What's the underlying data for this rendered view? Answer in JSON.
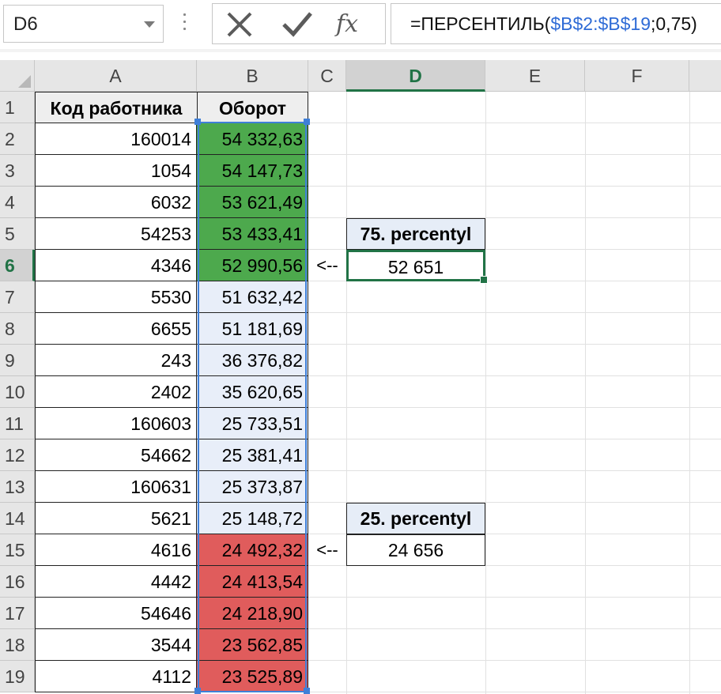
{
  "name_box": {
    "value": "D6"
  },
  "formula_bar": {
    "cancel_icon": "close-x-icon",
    "confirm_icon": "checkmark-icon",
    "fx_label": "fx",
    "formula_prefix": "=ПЕРСЕНТИЛЬ(",
    "formula_ref": "$B$2:$B$19",
    "formula_suffix": ";0,75)"
  },
  "columns": [
    "A",
    "B",
    "C",
    "D",
    "E",
    "F"
  ],
  "selected_column": "D",
  "rows": [
    "1",
    "2",
    "3",
    "4",
    "5",
    "6",
    "7",
    "8",
    "9",
    "10",
    "11",
    "12",
    "13",
    "14",
    "15",
    "16",
    "17",
    "18",
    "19"
  ],
  "selected_row": "6",
  "table": {
    "header_a": "Код работника",
    "header_b": "Оборот",
    "rows": [
      {
        "a": "160014",
        "b": "54 332,63"
      },
      {
        "a": "1054",
        "b": "54 147,73"
      },
      {
        "a": "6032",
        "b": "53 621,49"
      },
      {
        "a": "54253",
        "b": "53 433,41"
      },
      {
        "a": "4346",
        "b": "52 990,56"
      },
      {
        "a": "5530",
        "b": "51 632,42"
      },
      {
        "a": "6655",
        "b": "51 181,69"
      },
      {
        "a": "243",
        "b": "36 376,82"
      },
      {
        "a": "2402",
        "b": "35 620,65"
      },
      {
        "a": "160603",
        "b": "25 733,51"
      },
      {
        "a": "54662",
        "b": "25 381,41"
      },
      {
        "a": "160631",
        "b": "25 373,87"
      },
      {
        "a": "5621",
        "b": "25 148,72"
      },
      {
        "a": "4616",
        "b": "24 492,32"
      },
      {
        "a": "4442",
        "b": "24 413,54"
      },
      {
        "a": "54646",
        "b": "24 218,90"
      },
      {
        "a": "3544",
        "b": "23 562,85"
      },
      {
        "a": "4112",
        "b": "23 525,89"
      }
    ]
  },
  "colors": {
    "top_fill": "#4da94d",
    "mid_fill": "#e8eef9",
    "bottom_fill": "#e05c5c",
    "accent": "#217346",
    "selection": "#3f7fd8"
  },
  "arrows": {
    "arrow_top": "<--",
    "arrow_bottom": "<--"
  },
  "results": {
    "p75_label": "75. percentyl",
    "p75_value": "52 651",
    "p25_label": "25. percentyl",
    "p25_value": "24 656"
  }
}
